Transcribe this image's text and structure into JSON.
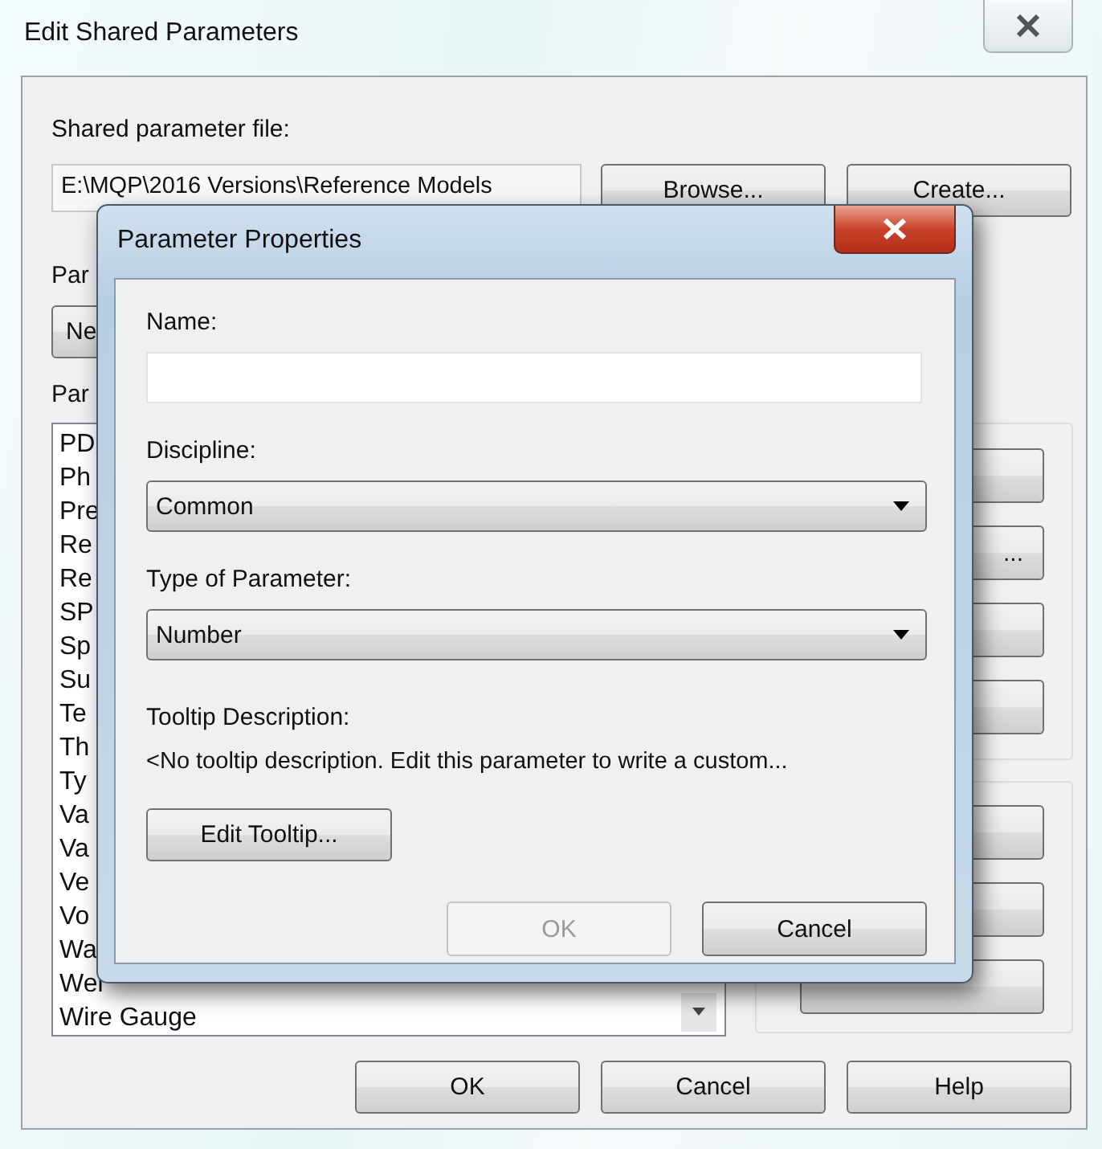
{
  "window": {
    "title": "Edit Shared Parameters"
  },
  "file": {
    "label": "Shared parameter file:",
    "value": "E:\\MQP\\2016 Versions\\Reference Models",
    "buttons": [
      "Browse...",
      "Create..."
    ]
  },
  "group": {
    "label": "Par",
    "button": "Ne"
  },
  "parameters": {
    "label": "Par",
    "items": [
      "PD",
      "Ph",
      "Pre",
      "Re",
      "Re",
      "SP",
      "Sp",
      "Su",
      "Te",
      "Th",
      "Ty",
      "Va",
      "Va",
      "Ve",
      "Vo",
      "Wa",
      "Wei",
      "Wire Gauge"
    ]
  },
  "side_panels": [
    {
      "buttons": [
        {
          "kind": "plain"
        },
        {
          "kind": "text",
          "label": "..."
        },
        {
          "kind": "plain"
        },
        {
          "kind": "plain"
        }
      ]
    },
    {
      "buttons": [
        {
          "kind": "plain"
        },
        {
          "kind": "plain"
        },
        {
          "kind": "plain"
        }
      ]
    }
  ],
  "buttons": [
    "OK",
    "Cancel",
    "Help"
  ],
  "dialog": {
    "title": "Parameter Properties",
    "name": {
      "label": "Name:"
    },
    "discipline": {
      "label": "Discipline:",
      "value": "Common"
    },
    "type": {
      "label": "Type of Parameter:",
      "value": "Number"
    },
    "tooltip": {
      "label": "Tooltip Description:",
      "text": "<No tooltip description. Edit this parameter to write a custom..."
    },
    "edit_button": "Edit Tooltip...",
    "buttons": [
      {
        "label": "OK",
        "disabled": true
      },
      {
        "label": "Cancel",
        "disabled": false
      }
    ]
  }
}
